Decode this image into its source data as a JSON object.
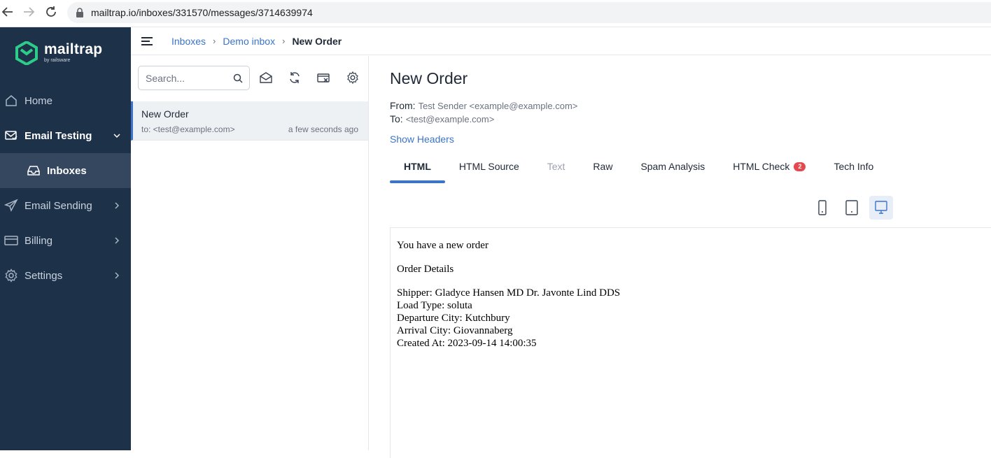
{
  "browser": {
    "url": "mailtrap.io/inboxes/331570/messages/3714639974",
    "icons": [
      "back-arrow-icon",
      "forward-arrow-icon",
      "reload-icon",
      "lock-icon"
    ]
  },
  "sidebar": {
    "logo": {
      "name": "mailtrap",
      "sub": "by railsware"
    },
    "items": [
      {
        "label": "Home",
        "icon": "home-icon"
      },
      {
        "label": "Email Testing",
        "icon": "email-testing-icon",
        "expanded": true
      },
      {
        "label": "Email Sending",
        "icon": "send-icon"
      },
      {
        "label": "Billing",
        "icon": "card-icon"
      },
      {
        "label": "Settings",
        "icon": "gear-icon"
      }
    ],
    "subitem": {
      "label": "Inboxes",
      "icon": "inbox-icon"
    }
  },
  "breadcrumb": {
    "items": [
      "Inboxes",
      "Demo inbox"
    ],
    "current": "New Order"
  },
  "list": {
    "search_placeholder": "Search...",
    "tools": [
      "mark-read-icon",
      "refresh-icon",
      "clear-inbox-icon",
      "settings-icon"
    ],
    "messages": [
      {
        "subject": "New Order",
        "to": "to: <test@example.com>",
        "time": "a few seconds ago"
      }
    ]
  },
  "message": {
    "title": "New Order",
    "from_label": "From:",
    "from_value": "Test Sender <example@example.com>",
    "to_label": "To:",
    "to_value": "<test@example.com>",
    "show_headers": "Show Headers",
    "tabs": [
      {
        "label": "HTML",
        "active": true
      },
      {
        "label": "HTML Source"
      },
      {
        "label": "Text",
        "disabled": true
      },
      {
        "label": "Raw"
      },
      {
        "label": "Spam Analysis"
      },
      {
        "label": "HTML Check",
        "badge": "2"
      },
      {
        "label": "Tech Info"
      }
    ],
    "devices": [
      "mobile-icon",
      "tablet-icon",
      "desktop-icon"
    ],
    "active_device": "desktop",
    "body": {
      "p1": "You have a new order",
      "p2": "Order Details",
      "shipper": "Shipper: Gladyce Hansen MD Dr. Javonte Lind DDS",
      "load_type": "Load Type: soluta",
      "departure": "Departure City: Kutchbury",
      "arrival": "Arrival City: Giovannaberg",
      "created": "Created At: 2023-09-14 14:00:35"
    }
  },
  "colors": {
    "sidebar": "#1d3148",
    "accent": "#3b74c9",
    "badge": "#e5484d",
    "logo": "#2ecc8a"
  }
}
